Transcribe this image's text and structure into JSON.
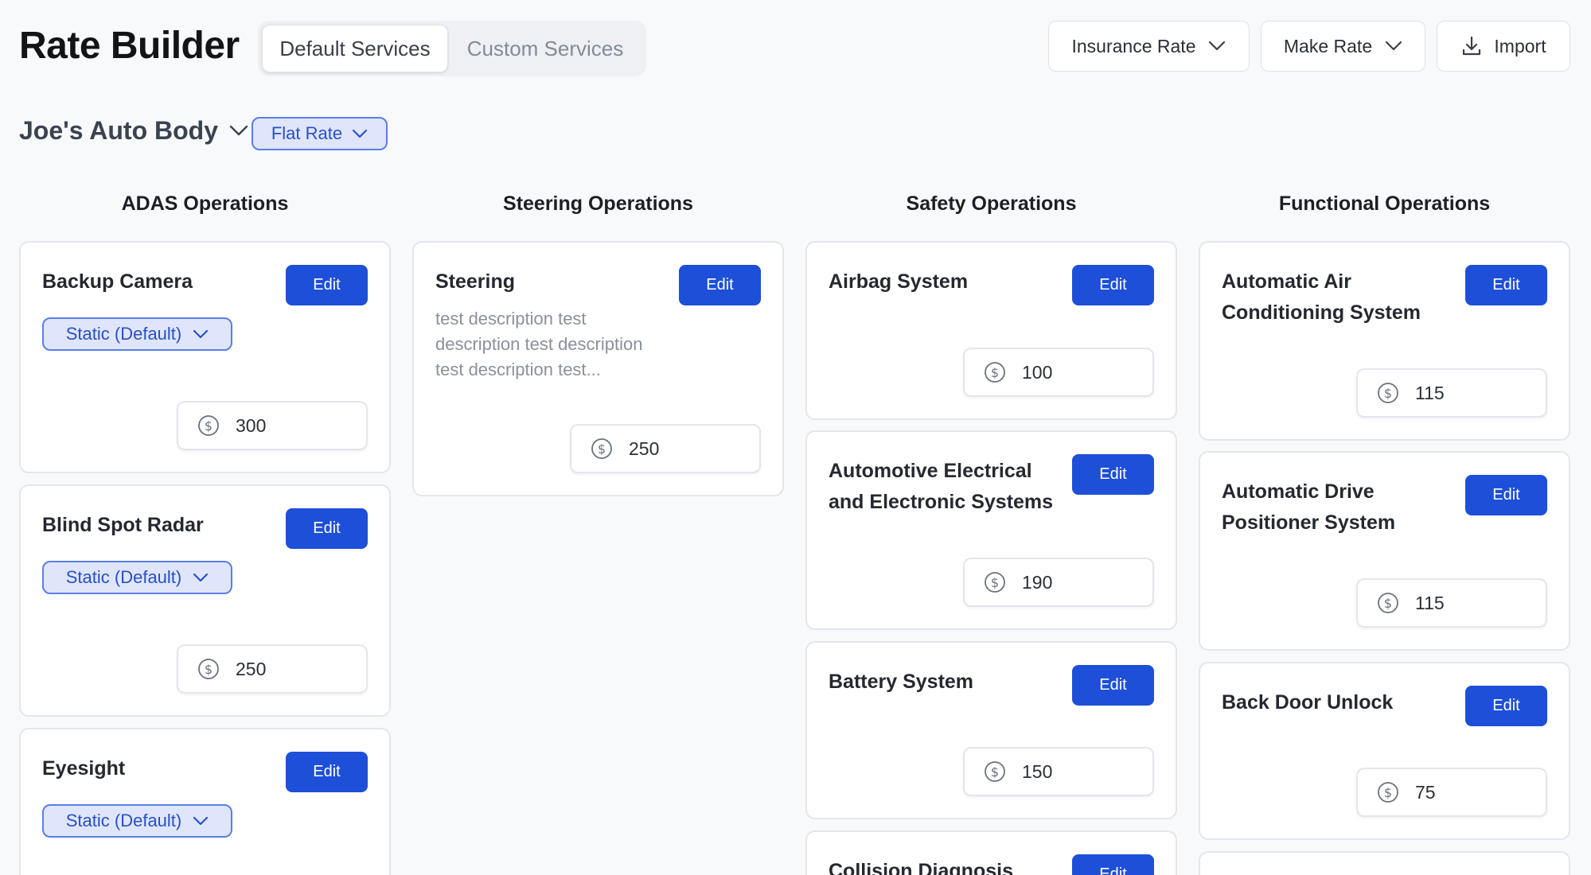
{
  "header": {
    "title": "Rate Builder",
    "tabs": [
      "Default Services",
      "Custom Services"
    ],
    "insurance_rate": "Insurance Rate",
    "make_rate": "Make Rate",
    "import": "Import"
  },
  "shop": {
    "name": "Joe's Auto Body",
    "rate_type": "Flat Rate"
  },
  "columns": [
    {
      "title": "ADAS Operations",
      "cards": [
        {
          "title": "Backup Camera",
          "edit": "Edit",
          "mode": "Static (Default)",
          "price": "300"
        },
        {
          "title": "Blind Spot Radar",
          "edit": "Edit",
          "mode": "Static (Default)",
          "price": "250"
        },
        {
          "title": "Eyesight",
          "edit": "Edit",
          "mode": "Static (Default)"
        }
      ]
    },
    {
      "title": "Steering Operations",
      "cards": [
        {
          "title": "Steering",
          "edit": "Edit",
          "description": "test description test description test description test description test...",
          "price": "250"
        }
      ]
    },
    {
      "title": "Safety Operations",
      "cards": [
        {
          "title": "Airbag System",
          "edit": "Edit",
          "price": "100"
        },
        {
          "title": "Automotive Electrical and Electronic Systems",
          "edit": "Edit",
          "price": "190"
        },
        {
          "title": "Battery System",
          "edit": "Edit",
          "price": "150"
        },
        {
          "title": "Collision Diagnosis",
          "edit": "Edit"
        }
      ]
    },
    {
      "title": "Functional Operations",
      "cards": [
        {
          "title": "Automatic Air Conditioning System",
          "edit": "Edit",
          "price": "115"
        },
        {
          "title": "Automatic Drive Positioner System",
          "edit": "Edit",
          "price": "115"
        },
        {
          "title": "Back Door Unlock",
          "edit": "Edit",
          "price": "75"
        }
      ]
    }
  ],
  "colors": {
    "accent": "#1d4fd8",
    "pill_bg": "#dfe6fb",
    "pill_border": "#5a7ee6"
  }
}
